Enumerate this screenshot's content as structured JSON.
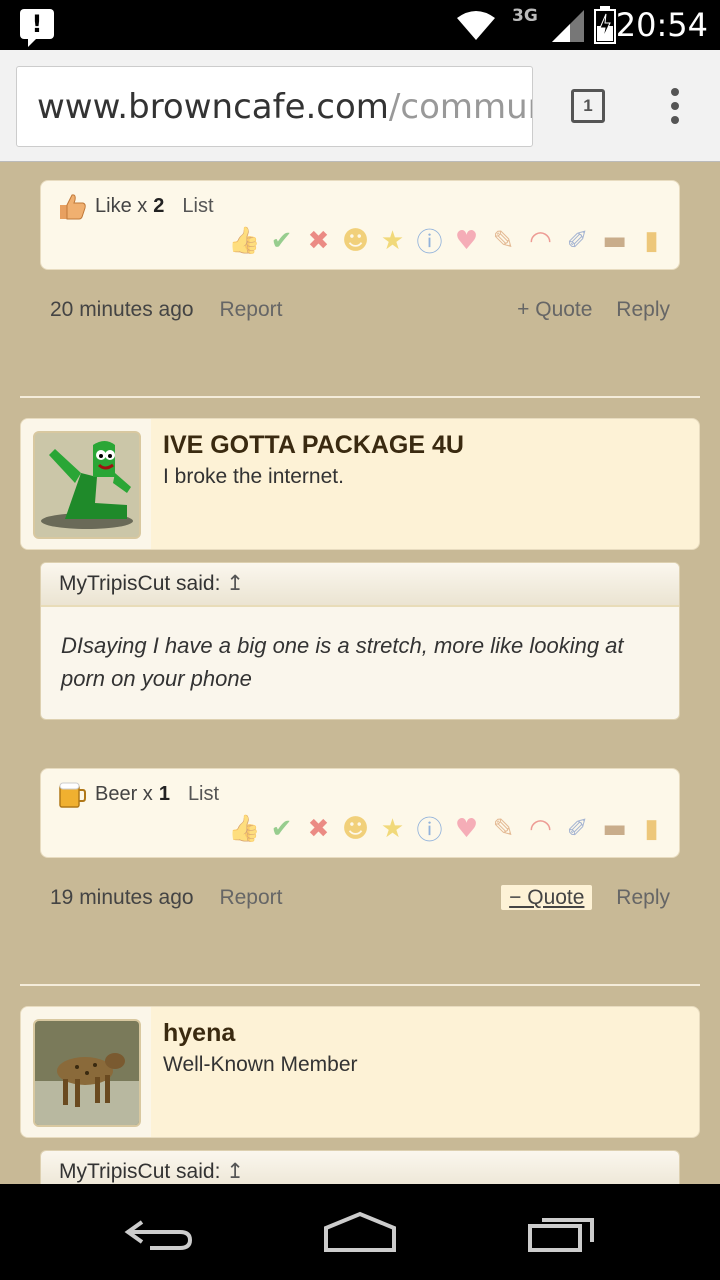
{
  "status_bar": {
    "network": "3G",
    "time": "20:54"
  },
  "browser": {
    "url_domain": "www.browncafe.com",
    "url_path": "/communi",
    "tab_count": "1"
  },
  "post1": {
    "reaction_summary": {
      "icon": "thumbs-up-icon",
      "label": "Like x",
      "count": "2",
      "list_label": "List"
    },
    "timestamp": "20 minutes ago",
    "report_label": "Report",
    "quote_label": "+ Quote",
    "reply_label": "Reply"
  },
  "post2": {
    "username": "IVE GOTTA PACKAGE 4U",
    "user_title": "I broke the internet.",
    "quote": {
      "author": "MyTripisCut said:",
      "arrow": "↥",
      "text": "DIsaying I have a big one is a stretch, more like looking at porn on your phone"
    },
    "reaction_summary": {
      "icon": "beer-icon",
      "label": "Beer x",
      "count": "1",
      "list_label": "List"
    },
    "timestamp": "19 minutes ago",
    "report_label": "Report",
    "quote_label": "− Quote",
    "reply_label": "Reply"
  },
  "post3": {
    "username": "hyena",
    "user_title": "Well-Known Member",
    "quote": {
      "author": "MyTripisCut said:",
      "arrow": "↥"
    }
  },
  "reaction_icons": [
    "like",
    "agree",
    "disagree",
    "funny",
    "winner",
    "informative",
    "love",
    "useful",
    "rainbow",
    "creative",
    "package",
    "beer"
  ],
  "colors": {
    "background": "#c8b996",
    "panel": "#fdf2d6",
    "accent_text": "#3a2a10"
  }
}
